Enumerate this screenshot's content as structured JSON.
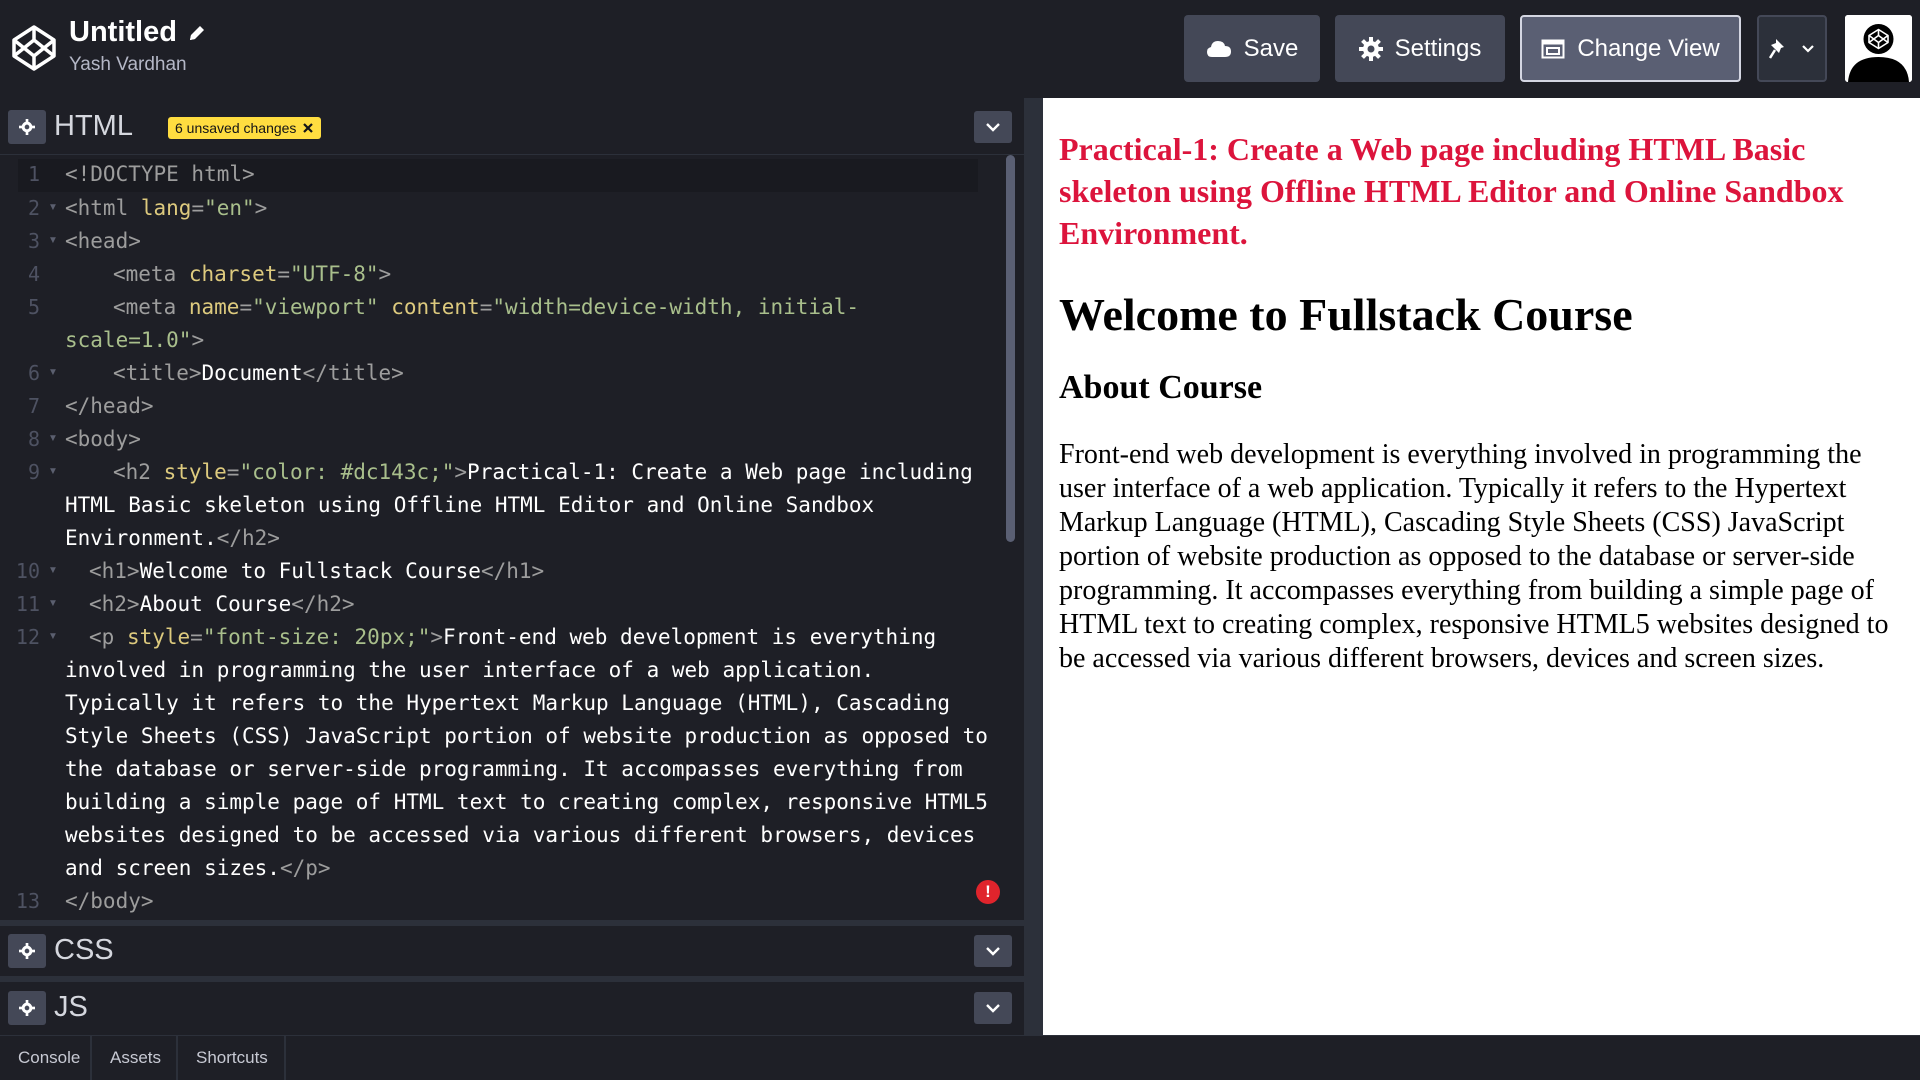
{
  "header": {
    "title": "Untitled",
    "author": "Yash Vardhan",
    "buttons": {
      "save": "Save",
      "settings": "Settings",
      "change_view": "Change View"
    }
  },
  "editor": {
    "html_label": "HTML",
    "unsaved_badge": "6 unsaved changes",
    "css_label": "CSS",
    "js_label": "JS",
    "line_numbers": [
      "1",
      "2",
      "3",
      "4",
      "5",
      "6",
      "7",
      "8",
      "9",
      "10",
      "11",
      "12",
      "13"
    ],
    "code": {
      "l1": "<!DOCTYPE html>",
      "l2": [
        "<html ",
        "lang",
        "=",
        "\"en\"",
        ">"
      ],
      "l3": "<head>",
      "l4": [
        "<meta ",
        "charset",
        "=",
        "\"UTF-8\"",
        ">"
      ],
      "l5a": [
        "<meta ",
        "name",
        "=",
        "\"viewport\"",
        " ",
        "content",
        "=",
        "\"width=device-width, initial-"
      ],
      "l5b": [
        "scale=1.0\"",
        ">"
      ],
      "l6": [
        "<title>",
        "Document",
        "</title>"
      ],
      "l7": "</head>",
      "l8": "<body>",
      "l9a": [
        "<h2 ",
        "style",
        "=",
        "\"color: #dc143c;\"",
        ">",
        "Practical-1: Create a Web page including"
      ],
      "l9b": "HTML Basic skeleton using Offline HTML Editor and Online Sandbox",
      "l9c": [
        "Environment.",
        "</h2>"
      ],
      "l10": [
        "<h1>",
        "Welcome to Fullstack Course",
        "</h1>"
      ],
      "l11": [
        "<h2>",
        "About Course",
        "</h2>"
      ],
      "l12a": [
        "<p ",
        "style",
        "=",
        "\"font-size: 20px;\"",
        ">",
        "Front-end web development is everything"
      ],
      "l12b": "involved in programming the user interface of a web application.",
      "l12c": "Typically it refers to the Hypertext Markup Language (HTML), Cascading",
      "l12d": "Style Sheets (CSS) JavaScript portion of website production as opposed to",
      "l12e": "the database or server-side programming. It accompasses everything from",
      "l12f": "building a simple page of HTML text to creating complex, responsive HTML5",
      "l12g": "websites designed to be accessed via various different browsers, devices",
      "l12h": [
        "and screen sizes.",
        "</p>"
      ],
      "l13": "</body>"
    }
  },
  "preview": {
    "h2_red": "Practical-1: Create a Web page including HTML Basic skeleton using Offline HTML Editor and Online Sandbox Environment.",
    "h1": "Welcome to Fullstack Course",
    "h2": "About Course",
    "paragraph": "Front-end web development is everything involved in programming the user interface of a web application. Typically it refers to the Hypertext Markup Language (HTML), Cascading Style Sheets (CSS) JavaScript portion of website production as opposed to the database or server-side programming. It accompasses everything from building a simple page of HTML text to creating complex, responsive HTML5 websites designed to be accessed via various different browsers, devices and screen sizes."
  },
  "footer": {
    "tabs": [
      "Console",
      "Assets",
      "Shortcuts"
    ]
  },
  "colors": {
    "accent_red": "#dc143c",
    "badge_yellow": "#ffdd40",
    "error_red": "#e0242c"
  },
  "icons": [
    "codepen-logo-icon",
    "pencil-icon",
    "cloud-icon",
    "gear-icon",
    "change-view-icon",
    "pin-icon",
    "chevron-down-icon",
    "close-icon",
    "error-icon",
    "avatar"
  ]
}
